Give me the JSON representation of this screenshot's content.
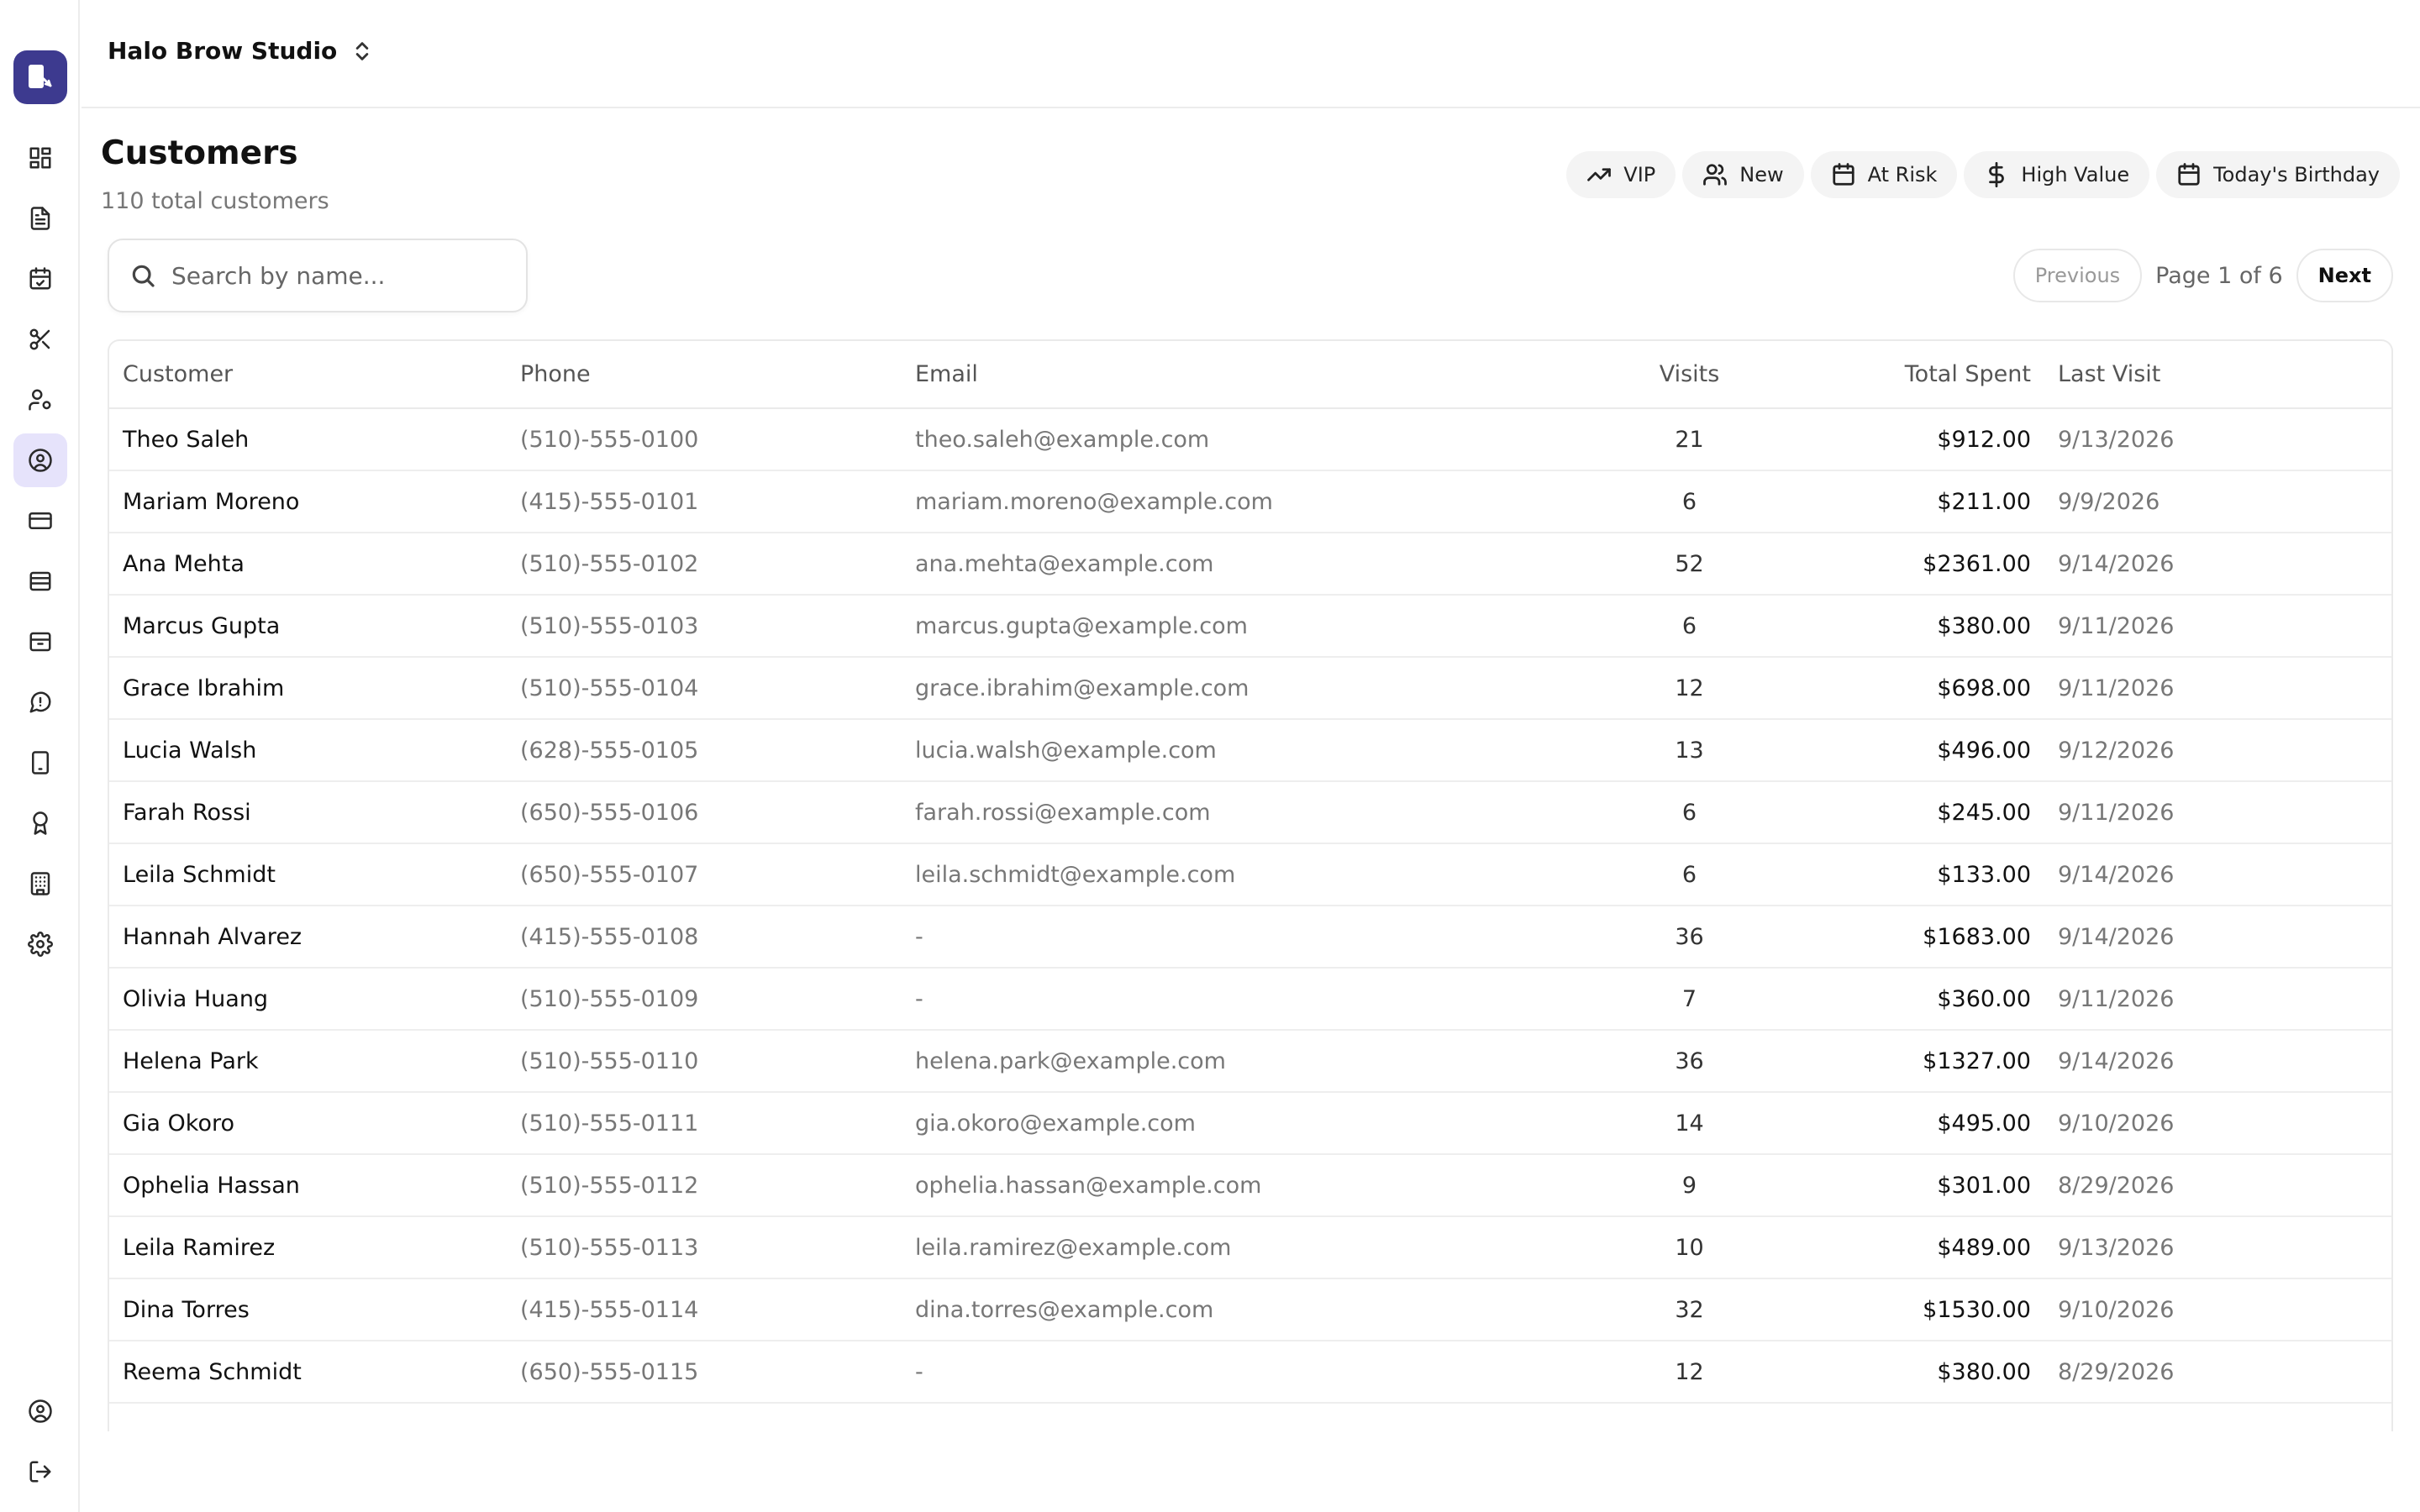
{
  "app": {
    "studio_name": "Halo Brow Studio"
  },
  "nav": {
    "logo": "app-logo-icon",
    "items": [
      {
        "icon": "dashboard-icon"
      },
      {
        "icon": "document-icon"
      },
      {
        "icon": "calendar-check-icon"
      },
      {
        "icon": "scissors-icon"
      },
      {
        "icon": "staff-settings-icon"
      },
      {
        "icon": "customers-icon",
        "active": true
      },
      {
        "icon": "credit-card-icon"
      },
      {
        "icon": "inventory-icon"
      },
      {
        "icon": "archive-icon"
      },
      {
        "icon": "chat-icon"
      },
      {
        "icon": "tablet-icon"
      },
      {
        "icon": "award-icon"
      },
      {
        "icon": "building-icon"
      },
      {
        "icon": "settings-icon"
      }
    ],
    "bottom": [
      {
        "icon": "account-icon"
      },
      {
        "icon": "logout-icon"
      }
    ]
  },
  "page": {
    "title": "Customers",
    "subtitle": "110 total customers"
  },
  "filters": [
    {
      "label": "VIP",
      "icon": "trending-up-icon"
    },
    {
      "label": "New",
      "icon": "users-icon"
    },
    {
      "label": "At Risk",
      "icon": "calendar-icon"
    },
    {
      "label": "High Value",
      "icon": "dollar-icon"
    },
    {
      "label": "Today's Birthday",
      "icon": "calendar-icon"
    }
  ],
  "search": {
    "placeholder": "Search by name..."
  },
  "pagination": {
    "previous": "Previous",
    "page_info": "Page 1 of 6",
    "next": "Next"
  },
  "table": {
    "columns": [
      "Customer",
      "Phone",
      "Email",
      "Visits",
      "Total Spent",
      "Last Visit"
    ],
    "rows": [
      [
        "Theo Saleh",
        "(510)-555-0100",
        "theo.saleh@example.com",
        "21",
        "$912.00",
        "9/13/2026"
      ],
      [
        "Mariam Moreno",
        "(415)-555-0101",
        "mariam.moreno@example.com",
        "6",
        "$211.00",
        "9/9/2026"
      ],
      [
        "Ana Mehta",
        "(510)-555-0102",
        "ana.mehta@example.com",
        "52",
        "$2361.00",
        "9/14/2026"
      ],
      [
        "Marcus Gupta",
        "(510)-555-0103",
        "marcus.gupta@example.com",
        "6",
        "$380.00",
        "9/11/2026"
      ],
      [
        "Grace Ibrahim",
        "(510)-555-0104",
        "grace.ibrahim@example.com",
        "12",
        "$698.00",
        "9/11/2026"
      ],
      [
        "Lucia Walsh",
        "(628)-555-0105",
        "lucia.walsh@example.com",
        "13",
        "$496.00",
        "9/12/2026"
      ],
      [
        "Farah Rossi",
        "(650)-555-0106",
        "farah.rossi@example.com",
        "6",
        "$245.00",
        "9/11/2026"
      ],
      [
        "Leila Schmidt",
        "(650)-555-0107",
        "leila.schmidt@example.com",
        "6",
        "$133.00",
        "9/14/2026"
      ],
      [
        "Hannah Alvarez",
        "(415)-555-0108",
        "-",
        "36",
        "$1683.00",
        "9/14/2026"
      ],
      [
        "Olivia Huang",
        "(510)-555-0109",
        "-",
        "7",
        "$360.00",
        "9/11/2026"
      ],
      [
        "Helena Park",
        "(510)-555-0110",
        "helena.park@example.com",
        "36",
        "$1327.00",
        "9/14/2026"
      ],
      [
        "Gia Okoro",
        "(510)-555-0111",
        "gia.okoro@example.com",
        "14",
        "$495.00",
        "9/10/2026"
      ],
      [
        "Ophelia Hassan",
        "(510)-555-0112",
        "ophelia.hassan@example.com",
        "9",
        "$301.00",
        "8/29/2026"
      ],
      [
        "Leila Ramirez",
        "(510)-555-0113",
        "leila.ramirez@example.com",
        "10",
        "$489.00",
        "9/13/2026"
      ],
      [
        "Dina Torres",
        "(415)-555-0114",
        "dina.torres@example.com",
        "32",
        "$1530.00",
        "9/10/2026"
      ],
      [
        "Reema Schmidt",
        "(650)-555-0115",
        "-",
        "12",
        "$380.00",
        "8/29/2026"
      ]
    ]
  },
  "colors": {
    "accent": "#3d3a8f",
    "active_nav_bg": "#e6e3fb"
  }
}
